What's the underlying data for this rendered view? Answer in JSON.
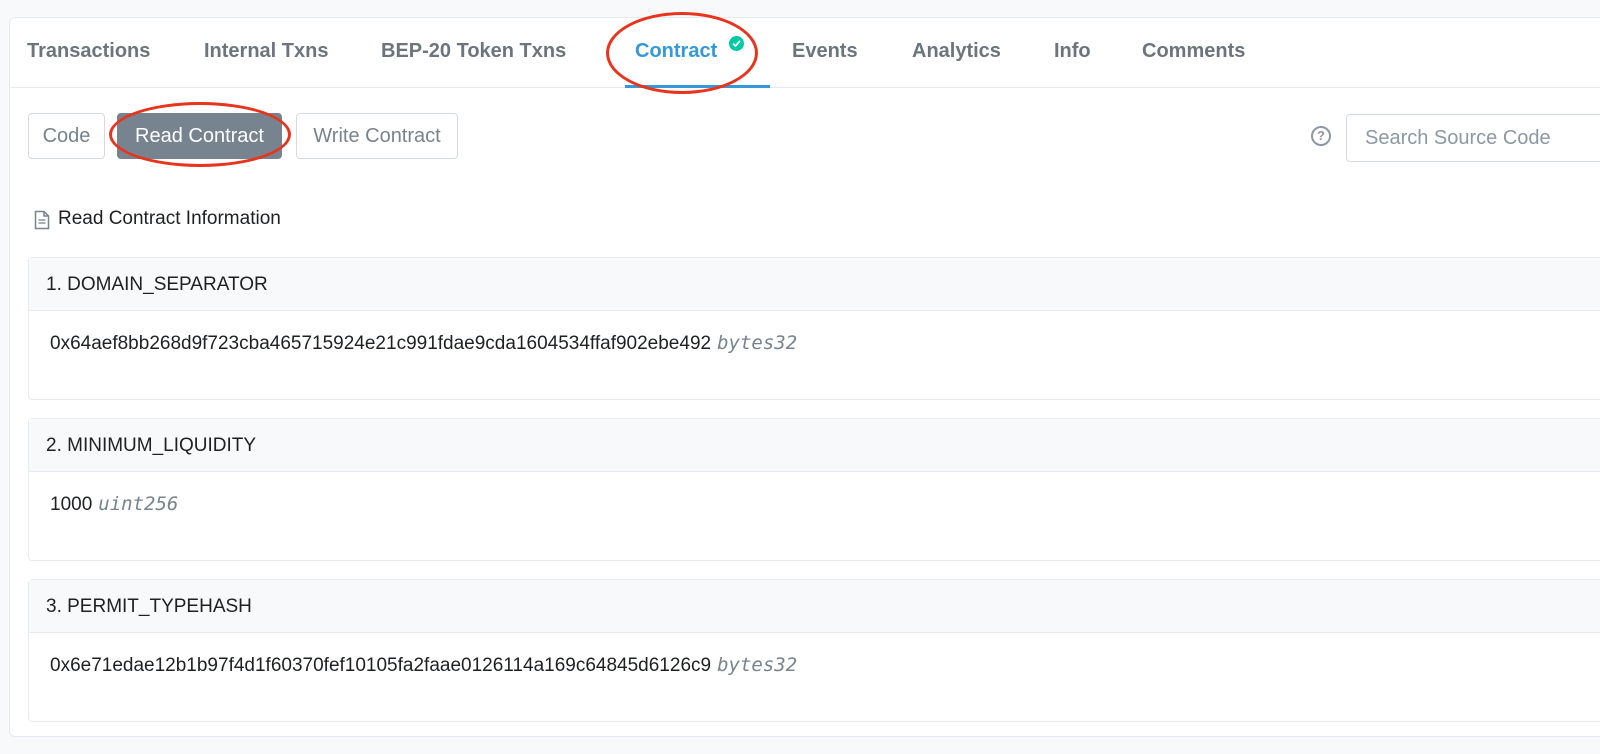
{
  "tabs": [
    {
      "label": "Transactions"
    },
    {
      "label": "Internal Txns"
    },
    {
      "label": "BEP-20 Token Txns"
    },
    {
      "label": "Contract"
    },
    {
      "label": "Events"
    },
    {
      "label": "Analytics"
    },
    {
      "label": "Info"
    },
    {
      "label": "Comments"
    }
  ],
  "active_tab": "Contract",
  "subtabs": [
    {
      "label": "Code"
    },
    {
      "label": "Read Contract"
    },
    {
      "label": "Write Contract"
    }
  ],
  "active_subtab": "Read Contract",
  "search": {
    "placeholder": "Search Source Code",
    "value": ""
  },
  "section_title": "Read Contract Information",
  "functions": [
    {
      "title": "1. DOMAIN_SEPARATOR",
      "value": "0x64aef8bb268d9f723cba465715924e21c991fdae9cda1604534ffaf902ebe492",
      "type": "bytes32"
    },
    {
      "title": "2. MINIMUM_LIQUIDITY",
      "value": "1000",
      "type": "uint256"
    },
    {
      "title": "3. PERMIT_TYPEHASH",
      "value": "0x6e71edae12b1b97f4d1f60370fef10105fa2faae0126114a169c64845d6126c9",
      "type": "bytes32"
    }
  ],
  "colors": {
    "accent": "#3498db",
    "verified": "#00c9a7",
    "annotation": "#e8341c",
    "active_button": "#77838f"
  },
  "icons": {
    "verified": "check-circle-icon",
    "help": "question-circle-icon",
    "document": "document-icon"
  }
}
